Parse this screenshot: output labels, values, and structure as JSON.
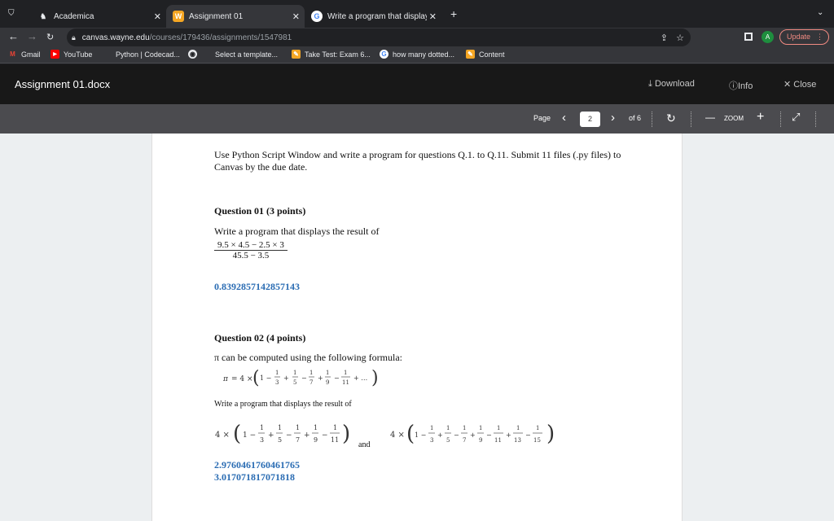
{
  "browser": {
    "tabs": [
      {
        "label": "Academica",
        "favicon": "academica-icon"
      },
      {
        "label": "Assignment 01",
        "favicon": "canvas-icon"
      },
      {
        "label": "Write a program that displays t",
        "favicon": "google-icon"
      }
    ],
    "url_host": "canvas.wayne.edu",
    "url_path": "/courses/179436/assignments/1547981",
    "profile_initial": "A",
    "update_label": "Update",
    "bookmarks": [
      "Gmail",
      "YouTube",
      "Python | Codecad...",
      "Select a template...",
      "Take Test: Exam 6...",
      "how many dotted...",
      "Content"
    ]
  },
  "viewer": {
    "title": "Assignment 01.docx",
    "download": "Download",
    "info": "Info",
    "close": "Close",
    "page_label": "Page",
    "page_current": "2",
    "page_total": "of 6",
    "zoom_label": "ZOOM"
  },
  "document": {
    "intro": "Use Python Script Window and write a program for questions Q.1. to Q.11. Submit 11 files (.py files) to Canvas by the due date.",
    "q1_title": "Question 01 (3 points)",
    "q1_text": "Write a program that displays the result of",
    "q1_numerator": "9.5 × 4.5 − 2.5 × 3",
    "q1_denominator": "45.5 − 3.5",
    "q1_answer": "0.8392857142857143",
    "q2_title": "Question 02 (4 points)",
    "q2_text": "π can be computed using the following formula:",
    "q2_prompt": "Write a program that displays the result of",
    "and_label": "and",
    "q2_answer1": "2.9760461760461765",
    "q2_answer2": "3.017071817071818"
  }
}
